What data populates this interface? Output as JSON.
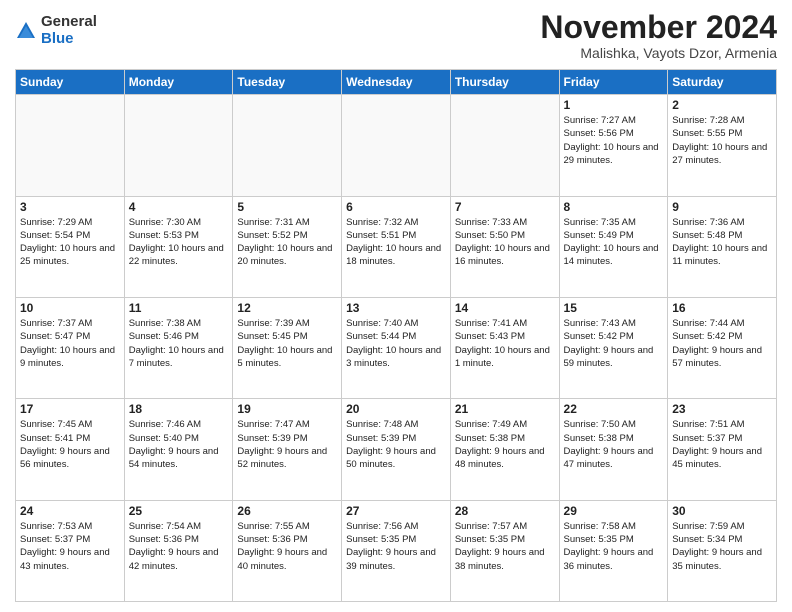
{
  "logo": {
    "general": "General",
    "blue": "Blue"
  },
  "header": {
    "month": "November 2024",
    "location": "Malishka, Vayots Dzor, Armenia"
  },
  "weekdays": [
    "Sunday",
    "Monday",
    "Tuesday",
    "Wednesday",
    "Thursday",
    "Friday",
    "Saturday"
  ],
  "weeks": [
    [
      {
        "day": "",
        "info": ""
      },
      {
        "day": "",
        "info": ""
      },
      {
        "day": "",
        "info": ""
      },
      {
        "day": "",
        "info": ""
      },
      {
        "day": "",
        "info": ""
      },
      {
        "day": "1",
        "info": "Sunrise: 7:27 AM\nSunset: 5:56 PM\nDaylight: 10 hours and 29 minutes."
      },
      {
        "day": "2",
        "info": "Sunrise: 7:28 AM\nSunset: 5:55 PM\nDaylight: 10 hours and 27 minutes."
      }
    ],
    [
      {
        "day": "3",
        "info": "Sunrise: 7:29 AM\nSunset: 5:54 PM\nDaylight: 10 hours and 25 minutes."
      },
      {
        "day": "4",
        "info": "Sunrise: 7:30 AM\nSunset: 5:53 PM\nDaylight: 10 hours and 22 minutes."
      },
      {
        "day": "5",
        "info": "Sunrise: 7:31 AM\nSunset: 5:52 PM\nDaylight: 10 hours and 20 minutes."
      },
      {
        "day": "6",
        "info": "Sunrise: 7:32 AM\nSunset: 5:51 PM\nDaylight: 10 hours and 18 minutes."
      },
      {
        "day": "7",
        "info": "Sunrise: 7:33 AM\nSunset: 5:50 PM\nDaylight: 10 hours and 16 minutes."
      },
      {
        "day": "8",
        "info": "Sunrise: 7:35 AM\nSunset: 5:49 PM\nDaylight: 10 hours and 14 minutes."
      },
      {
        "day": "9",
        "info": "Sunrise: 7:36 AM\nSunset: 5:48 PM\nDaylight: 10 hours and 11 minutes."
      }
    ],
    [
      {
        "day": "10",
        "info": "Sunrise: 7:37 AM\nSunset: 5:47 PM\nDaylight: 10 hours and 9 minutes."
      },
      {
        "day": "11",
        "info": "Sunrise: 7:38 AM\nSunset: 5:46 PM\nDaylight: 10 hours and 7 minutes."
      },
      {
        "day": "12",
        "info": "Sunrise: 7:39 AM\nSunset: 5:45 PM\nDaylight: 10 hours and 5 minutes."
      },
      {
        "day": "13",
        "info": "Sunrise: 7:40 AM\nSunset: 5:44 PM\nDaylight: 10 hours and 3 minutes."
      },
      {
        "day": "14",
        "info": "Sunrise: 7:41 AM\nSunset: 5:43 PM\nDaylight: 10 hours and 1 minute."
      },
      {
        "day": "15",
        "info": "Sunrise: 7:43 AM\nSunset: 5:42 PM\nDaylight: 9 hours and 59 minutes."
      },
      {
        "day": "16",
        "info": "Sunrise: 7:44 AM\nSunset: 5:42 PM\nDaylight: 9 hours and 57 minutes."
      }
    ],
    [
      {
        "day": "17",
        "info": "Sunrise: 7:45 AM\nSunset: 5:41 PM\nDaylight: 9 hours and 56 minutes."
      },
      {
        "day": "18",
        "info": "Sunrise: 7:46 AM\nSunset: 5:40 PM\nDaylight: 9 hours and 54 minutes."
      },
      {
        "day": "19",
        "info": "Sunrise: 7:47 AM\nSunset: 5:39 PM\nDaylight: 9 hours and 52 minutes."
      },
      {
        "day": "20",
        "info": "Sunrise: 7:48 AM\nSunset: 5:39 PM\nDaylight: 9 hours and 50 minutes."
      },
      {
        "day": "21",
        "info": "Sunrise: 7:49 AM\nSunset: 5:38 PM\nDaylight: 9 hours and 48 minutes."
      },
      {
        "day": "22",
        "info": "Sunrise: 7:50 AM\nSunset: 5:38 PM\nDaylight: 9 hours and 47 minutes."
      },
      {
        "day": "23",
        "info": "Sunrise: 7:51 AM\nSunset: 5:37 PM\nDaylight: 9 hours and 45 minutes."
      }
    ],
    [
      {
        "day": "24",
        "info": "Sunrise: 7:53 AM\nSunset: 5:37 PM\nDaylight: 9 hours and 43 minutes."
      },
      {
        "day": "25",
        "info": "Sunrise: 7:54 AM\nSunset: 5:36 PM\nDaylight: 9 hours and 42 minutes."
      },
      {
        "day": "26",
        "info": "Sunrise: 7:55 AM\nSunset: 5:36 PM\nDaylight: 9 hours and 40 minutes."
      },
      {
        "day": "27",
        "info": "Sunrise: 7:56 AM\nSunset: 5:35 PM\nDaylight: 9 hours and 39 minutes."
      },
      {
        "day": "28",
        "info": "Sunrise: 7:57 AM\nSunset: 5:35 PM\nDaylight: 9 hours and 38 minutes."
      },
      {
        "day": "29",
        "info": "Sunrise: 7:58 AM\nSunset: 5:35 PM\nDaylight: 9 hours and 36 minutes."
      },
      {
        "day": "30",
        "info": "Sunrise: 7:59 AM\nSunset: 5:34 PM\nDaylight: 9 hours and 35 minutes."
      }
    ]
  ]
}
